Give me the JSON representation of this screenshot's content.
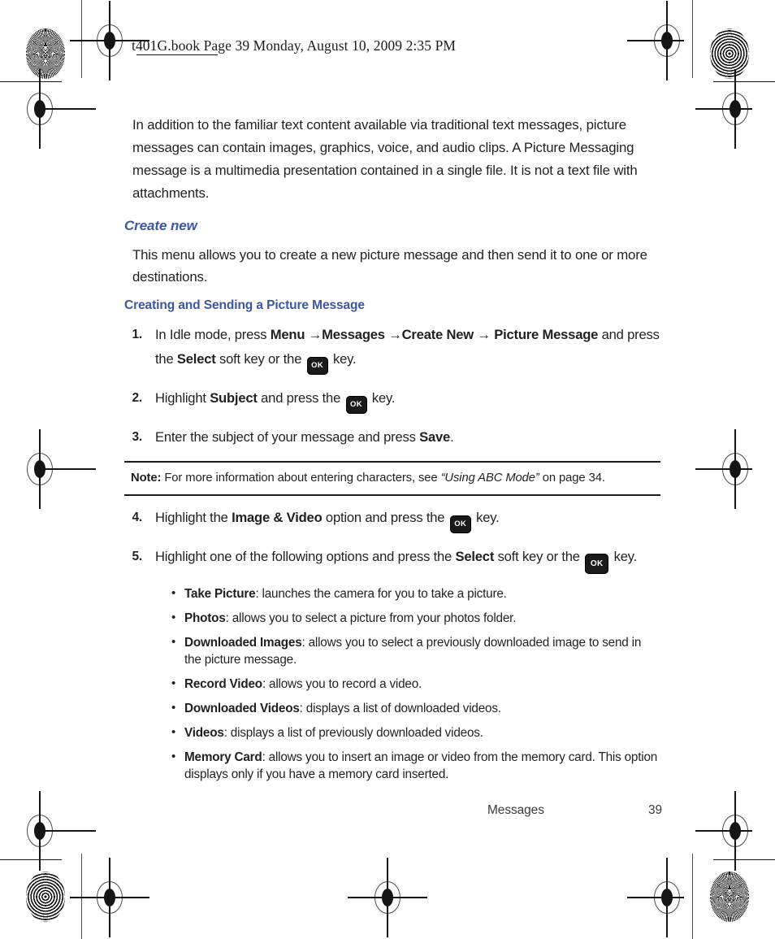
{
  "header": {
    "text": "t401G.book  Page 39  Monday, August 10, 2009  2:35 PM"
  },
  "colors": {
    "heading_blue": "#3c56a5",
    "body_text": "#231f20",
    "key_background": "#1a1a1a"
  },
  "content": {
    "intro": "In addition to the familiar text content available via traditional text messages, picture messages can contain images, graphics, voice, and audio clips. A Picture Messaging message is a multimedia presentation contained in a single file. It is not a text file with attachments.",
    "section_heading": "Create new",
    "section_paragraph": "This menu allows you to create a new picture message and then send it to one or more destinations.",
    "subsection_heading": "Creating and Sending a Picture Message",
    "steps": [
      {
        "number": "1.",
        "segments": [
          {
            "text": "In Idle mode, press ",
            "style": "normal"
          },
          {
            "text": "Menu",
            "style": "bold"
          },
          {
            "text": " →",
            "style": "bold"
          },
          {
            "text": "Messages",
            "style": "bold"
          },
          {
            "text": " →",
            "style": "bold"
          },
          {
            "text": "Create New",
            "style": "bold"
          },
          {
            "text": " → ",
            "style": "bold"
          },
          {
            "text": "Picture Message",
            "style": "bold"
          },
          {
            "text": " and press the ",
            "style": "normal"
          },
          {
            "text": "Select",
            "style": "bold"
          },
          {
            "text": " soft key or the ",
            "style": "normal"
          },
          {
            "text": "OK",
            "style": "key"
          },
          {
            "text": " key.",
            "style": "normal"
          }
        ]
      },
      {
        "number": "2.",
        "segments": [
          {
            "text": "Highlight ",
            "style": "normal"
          },
          {
            "text": "Subject",
            "style": "bold"
          },
          {
            "text": " and press the ",
            "style": "normal"
          },
          {
            "text": "OK",
            "style": "key"
          },
          {
            "text": " key.",
            "style": "normal"
          }
        ]
      },
      {
        "number": "3.",
        "segments": [
          {
            "text": "Enter the subject of your message and press ",
            "style": "normal"
          },
          {
            "text": "Save",
            "style": "bold"
          },
          {
            "text": ".",
            "style": "normal"
          }
        ]
      }
    ],
    "note": {
      "label": "Note:",
      "text_before": " For more information about entering characters, see ",
      "italic_text": "“Using ABC Mode”",
      "text_after": " on page 34."
    },
    "steps_after_note": [
      {
        "number": "4.",
        "segments": [
          {
            "text": "Highlight the ",
            "style": "normal"
          },
          {
            "text": "Image & Video",
            "style": "bold"
          },
          {
            "text": " option and press the ",
            "style": "normal"
          },
          {
            "text": "OK",
            "style": "key"
          },
          {
            "text": " key.",
            "style": "normal"
          }
        ]
      },
      {
        "number": "5.",
        "segments": [
          {
            "text": "Highlight one of the following options and press the ",
            "style": "normal"
          },
          {
            "text": "Select",
            "style": "bold"
          },
          {
            "text": " soft key or the ",
            "style": "normal"
          },
          {
            "text": "OK",
            "style": "key-big"
          },
          {
            "text": " key.",
            "style": "normal"
          }
        ]
      }
    ],
    "bullets": [
      {
        "term": "Take Picture",
        "description": ": launches the camera for you to take a picture."
      },
      {
        "term": "Photos",
        "description": ": allows you to select a picture from your photos folder."
      },
      {
        "term": "Downloaded Images",
        "description": ": allows you to select a previously downloaded image to send in the picture message."
      },
      {
        "term": "Record Video",
        "description": ": allows you to record a video."
      },
      {
        "term": "Downloaded Videos",
        "description": ": displays a list of downloaded videos."
      },
      {
        "term": "Videos",
        "description": ": displays a list of previously downloaded videos."
      },
      {
        "term": "Memory Card",
        "description": ": allows you to insert an image or video from the memory card. This option displays only if you have a memory card inserted."
      }
    ]
  },
  "footer": {
    "chapter": "Messages",
    "page_number": "39"
  }
}
